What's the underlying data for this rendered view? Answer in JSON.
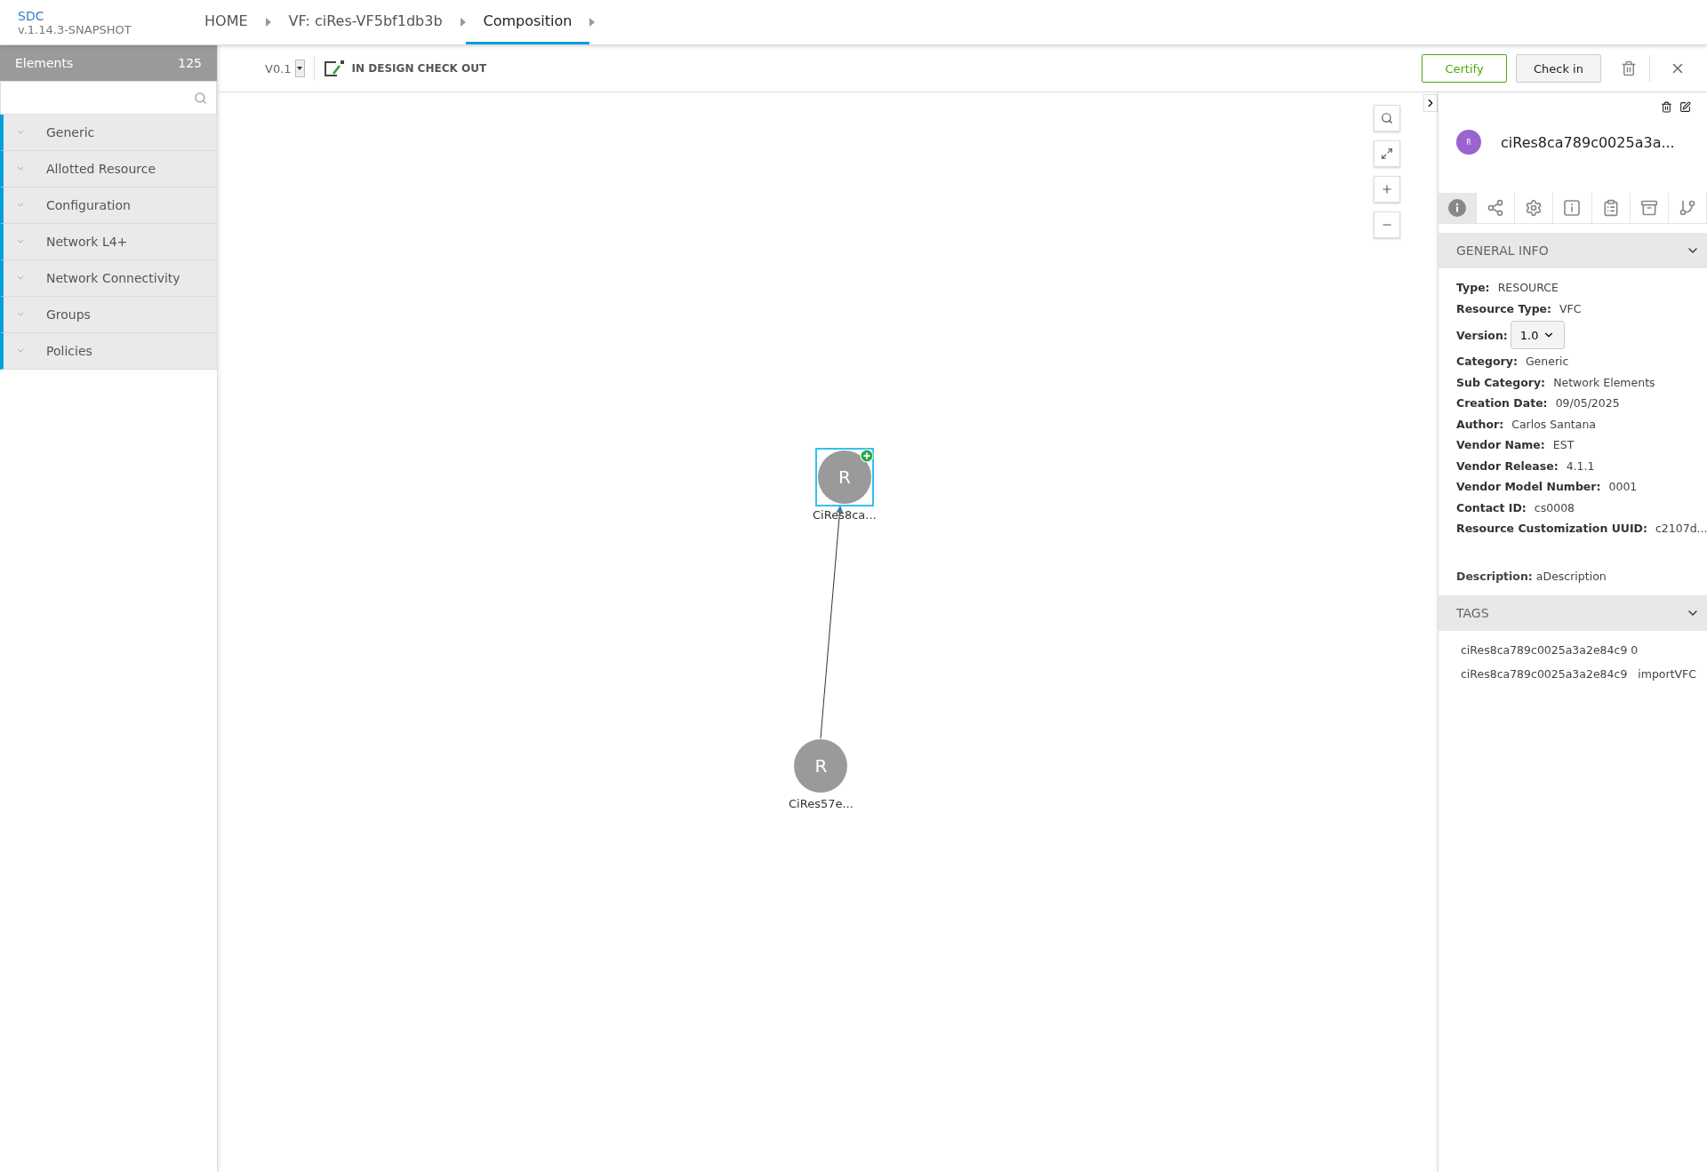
{
  "app": {
    "name": "SDC",
    "version": "v.1.14.3-SNAPSHOT"
  },
  "breadcrumbs": [
    {
      "label": "HOME",
      "selected": false
    },
    {
      "label": "VF: ciRes-VF5bf1db3b",
      "selected": false
    },
    {
      "label": "Composition",
      "selected": true
    }
  ],
  "sidebar": {
    "title": "Elements",
    "count": "125",
    "items": [
      {
        "label": "Generic"
      },
      {
        "label": "Allotted Resource"
      },
      {
        "label": "Configuration"
      },
      {
        "label": "Network L4+"
      },
      {
        "label": "Network Connectivity"
      },
      {
        "label": "Groups"
      },
      {
        "label": "Policies"
      }
    ]
  },
  "toolbar": {
    "version": "V0.1",
    "status": "IN DESIGN CHECK OUT",
    "buttons": [
      {
        "label": "Certify",
        "kind": "primary"
      },
      {
        "label": "Check in",
        "kind": "secondary"
      }
    ]
  },
  "canvas": {
    "nodes": [
      {
        "letter": "R",
        "label": "CiRes8ca...",
        "selected": true
      },
      {
        "letter": "R",
        "label": "CiRes57e...",
        "selected": false
      }
    ]
  },
  "panel": {
    "avatar": "R",
    "name": "ciRes8ca789c0025a3a...",
    "tabs": [
      {
        "kind": "info",
        "selected": true
      },
      {
        "kind": "composition",
        "selected": false
      },
      {
        "kind": "settings",
        "selected": false
      },
      {
        "kind": "details",
        "selected": false
      },
      {
        "kind": "clipboard",
        "selected": false
      },
      {
        "kind": "archive",
        "selected": false
      },
      {
        "kind": "branch",
        "selected": false
      }
    ],
    "general_info": {
      "title": "GENERAL INFO",
      "expanded": true,
      "fields": [
        {
          "label": "Type:",
          "value": "RESOURCE",
          "kind": "text"
        },
        {
          "label": "Resource Type:",
          "value": "VFC",
          "kind": "text"
        },
        {
          "label": "Version:",
          "value": "1.0",
          "kind": "select"
        },
        {
          "label": "Category:",
          "value": "Generic",
          "kind": "text"
        },
        {
          "label": "Sub Category:",
          "value": "Network Elements",
          "kind": "text"
        },
        {
          "label": "Creation Date:",
          "value": "09/05/2025",
          "kind": "text"
        },
        {
          "label": "Author:",
          "value": "Carlos Santana",
          "kind": "text"
        },
        {
          "label": "Vendor Name:",
          "value": "EST",
          "kind": "text"
        },
        {
          "label": "Vendor Release:",
          "value": "4.1.1",
          "kind": "text"
        },
        {
          "label": "Vendor Model Number:",
          "value": "0001",
          "kind": "text"
        },
        {
          "label": "Contact ID:",
          "value": "cs0008",
          "kind": "text"
        },
        {
          "label": "Resource Customization UUID:",
          "value": "c2107d...",
          "kind": "text"
        }
      ],
      "description": {
        "label": "Description:",
        "value": "aDescription"
      }
    },
    "tags": {
      "title": "TAGS",
      "expanded": true,
      "items": [
        "ciRes8ca789c0025a3a2e84c9 0",
        "ciRes8ca789c0025a3a2e84c9   importVFC"
      ]
    }
  }
}
